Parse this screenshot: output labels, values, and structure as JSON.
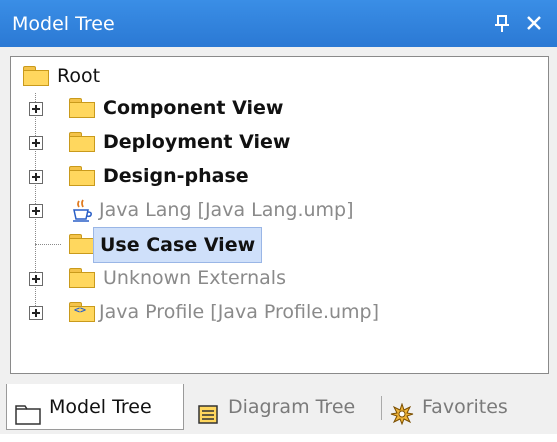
{
  "window": {
    "title": "Model Tree",
    "pin_glyph": "†",
    "close_glyph": "×"
  },
  "tree": {
    "root": {
      "label": "Root",
      "icon": "folder-icon"
    },
    "children": [
      {
        "label": "Component View",
        "icon": "folder-icon",
        "style": "bold",
        "expandable": true
      },
      {
        "label": "Deployment View",
        "icon": "folder-icon",
        "style": "bold",
        "expandable": true
      },
      {
        "label": "Design-phase",
        "icon": "folder-icon",
        "style": "bold",
        "expandable": true
      },
      {
        "label": "Java Lang [Java Lang.ump]",
        "icon": "java-coffee-icon",
        "style": "gray",
        "expandable": true
      },
      {
        "label": "Use Case View",
        "icon": "folder-icon",
        "style": "bold",
        "expandable": false,
        "selected": true
      },
      {
        "label": "Unknown Externals",
        "icon": "folder-icon",
        "style": "gray",
        "expandable": true
      },
      {
        "label": "Java Profile [Java Profile.ump]",
        "icon": "code-folder-icon",
        "style": "gray",
        "expandable": true
      }
    ]
  },
  "tabs": [
    {
      "label": "Model Tree",
      "icon": "folder-icon",
      "active": true
    },
    {
      "label": "Diagram Tree",
      "icon": "diagram-list-icon",
      "active": false
    },
    {
      "label": "Favorites",
      "icon": "star-burst-icon",
      "active": false
    }
  ],
  "colors": {
    "titlebar": "#2f82dd",
    "selection": "#cfe0fa",
    "folder": "#ffd75e",
    "gray_text": "#8a8a8a"
  }
}
